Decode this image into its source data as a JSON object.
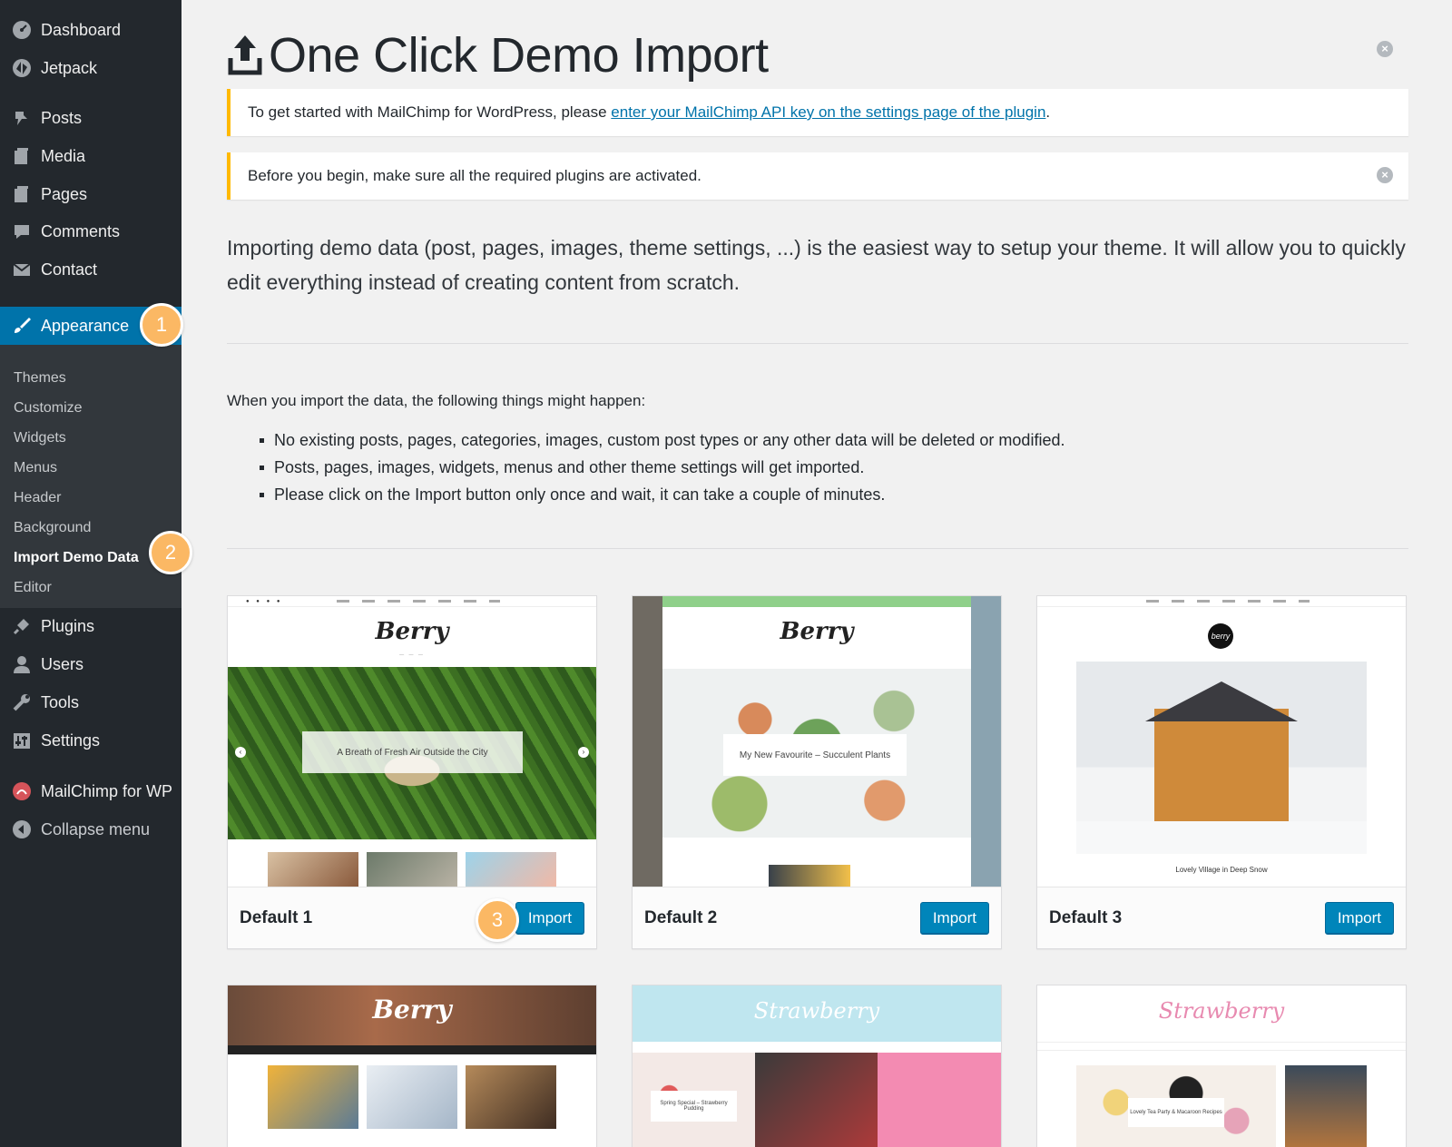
{
  "sidebar": {
    "items": [
      {
        "label": "Dashboard",
        "icon": "dashboard-icon"
      },
      {
        "label": "Jetpack",
        "icon": "jetpack-icon"
      },
      {
        "label": "Posts",
        "icon": "pushpin-icon"
      },
      {
        "label": "Media",
        "icon": "media-icon"
      },
      {
        "label": "Pages",
        "icon": "pages-icon"
      },
      {
        "label": "Comments",
        "icon": "comment-bubble-icon"
      },
      {
        "label": "Contact",
        "icon": "envelope-icon"
      },
      {
        "label": "Appearance",
        "icon": "paintbrush-icon"
      },
      {
        "label": "Plugins",
        "icon": "plug-icon"
      },
      {
        "label": "Users",
        "icon": "user-icon"
      },
      {
        "label": "Tools",
        "icon": "wrench-icon"
      },
      {
        "label": "Settings",
        "icon": "sliders-icon"
      },
      {
        "label": "MailChimp for WP",
        "icon": "mailchimp-icon"
      },
      {
        "label": "Collapse menu",
        "icon": "collapse-arrow-icon"
      }
    ],
    "submenu": [
      "Themes",
      "Customize",
      "Widgets",
      "Menus",
      "Header",
      "Background",
      "Import Demo Data",
      "Editor"
    ],
    "badges": [
      "1",
      "2",
      "3"
    ]
  },
  "header": {
    "title": "One Click Demo Import"
  },
  "notices": {
    "mailchimp_text": "To get started with MailChimp for WordPress, please ",
    "mailchimp_link": "enter your MailChimp API key on the settings page of the plugin",
    "mailchimp_end": ".",
    "plugins_text": "Before you begin, make sure all the required plugins are activated."
  },
  "intro": "Importing demo data (post, pages, images, theme settings, ...) is the easiest way to setup your theme. It will allow you to quickly edit everything instead of creating content from scratch.",
  "warnings": {
    "heading": "When you import the data, the following things might happen:",
    "items": [
      "No existing posts, pages, categories, images, custom post types or any other data will be deleted or modified.",
      "Posts, pages, images, widgets, menus and other theme settings will get imported.",
      "Please click on the Import button only once and wait, it can take a couple of minutes."
    ]
  },
  "demos": [
    {
      "name": "Default 1",
      "button": "Import",
      "logo": "Berry",
      "hero": "A Breath of Fresh Air Outside the City"
    },
    {
      "name": "Default 2",
      "button": "Import",
      "logo": "Berry",
      "hero": "My New Favourite – Succulent Plants"
    },
    {
      "name": "Default 3",
      "button": "Import",
      "logo": "berry",
      "hero": "Lovely Village in Deep Snow"
    },
    {
      "logo": "Berry"
    },
    {
      "logo": "Strawberry",
      "hero": "Spring Special – Strawberry Pudding"
    },
    {
      "logo": "Strawberry",
      "hero": "Lovely Tea Party & Macaroon Recipes"
    }
  ],
  "colors": {
    "accent": "#0073aa",
    "sidebar": "#23282d",
    "warning": "#ffb900",
    "badge": "#fbb864"
  }
}
